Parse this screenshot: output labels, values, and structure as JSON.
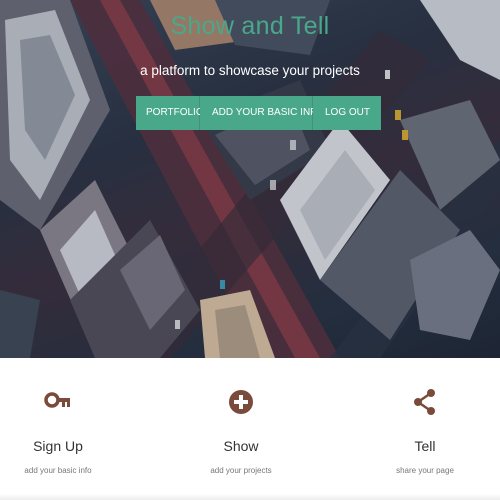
{
  "hero": {
    "title": "Show and Tell",
    "subtitle": "a platform to showcase your projects"
  },
  "nav": {
    "portfolio": "PORTFOLIO",
    "basic_info": "ADD YOUR BASIC INFO",
    "logout": "LOG OUT"
  },
  "features": [
    {
      "icon": "key-icon",
      "title": "Sign Up",
      "text": "add your basic info"
    },
    {
      "icon": "plus-circle-icon",
      "title": "Show",
      "text": "add your projects"
    },
    {
      "icon": "share-icon",
      "title": "Tell",
      "text": "share your page"
    }
  ],
  "colors": {
    "accent": "#4aa88a",
    "icon": "#7a4a3a",
    "text": "#333333",
    "muted": "#777777"
  }
}
